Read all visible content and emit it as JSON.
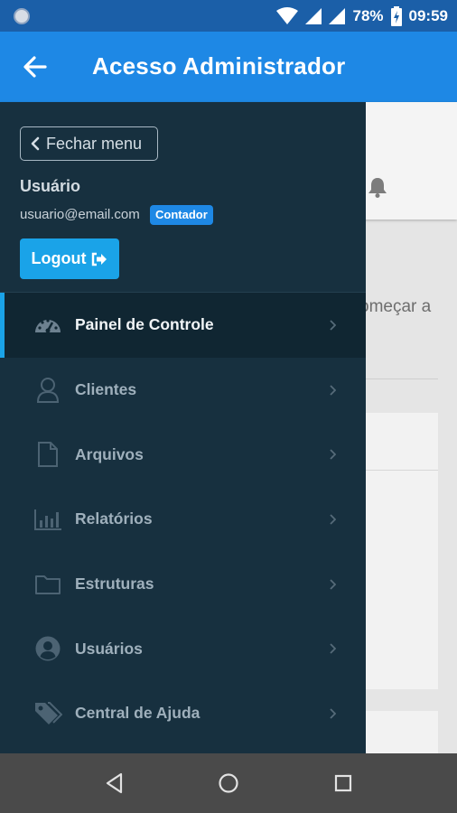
{
  "status_bar": {
    "battery": "78%",
    "time": "09:59"
  },
  "app_bar": {
    "title": "Acesso Administrador"
  },
  "background": {
    "partial_text": "omeçar a"
  },
  "drawer": {
    "close_label": "Fechar menu",
    "user_name": "Usuário",
    "user_email": "usuario@email.com",
    "role_badge": "Contador",
    "logout_label": "Logout",
    "menu": [
      {
        "label": "Painel de Controle",
        "icon": "dashboard-icon",
        "active": true
      },
      {
        "label": "Clientes",
        "icon": "user-icon",
        "active": false
      },
      {
        "label": "Arquivos",
        "icon": "file-icon",
        "active": false
      },
      {
        "label": "Relatórios",
        "icon": "bar-chart-icon",
        "active": false
      },
      {
        "label": "Estruturas",
        "icon": "folder-icon",
        "active": false
      },
      {
        "label": "Usuários",
        "icon": "user-circle-icon",
        "active": false
      },
      {
        "label": "Central de Ajuda",
        "icon": "tags-icon",
        "active": false
      }
    ]
  },
  "colors": {
    "status_bar": "#1b5fa8",
    "app_bar": "#1e88e5",
    "drawer": "#17303f",
    "accent": "#1aa3e8"
  }
}
